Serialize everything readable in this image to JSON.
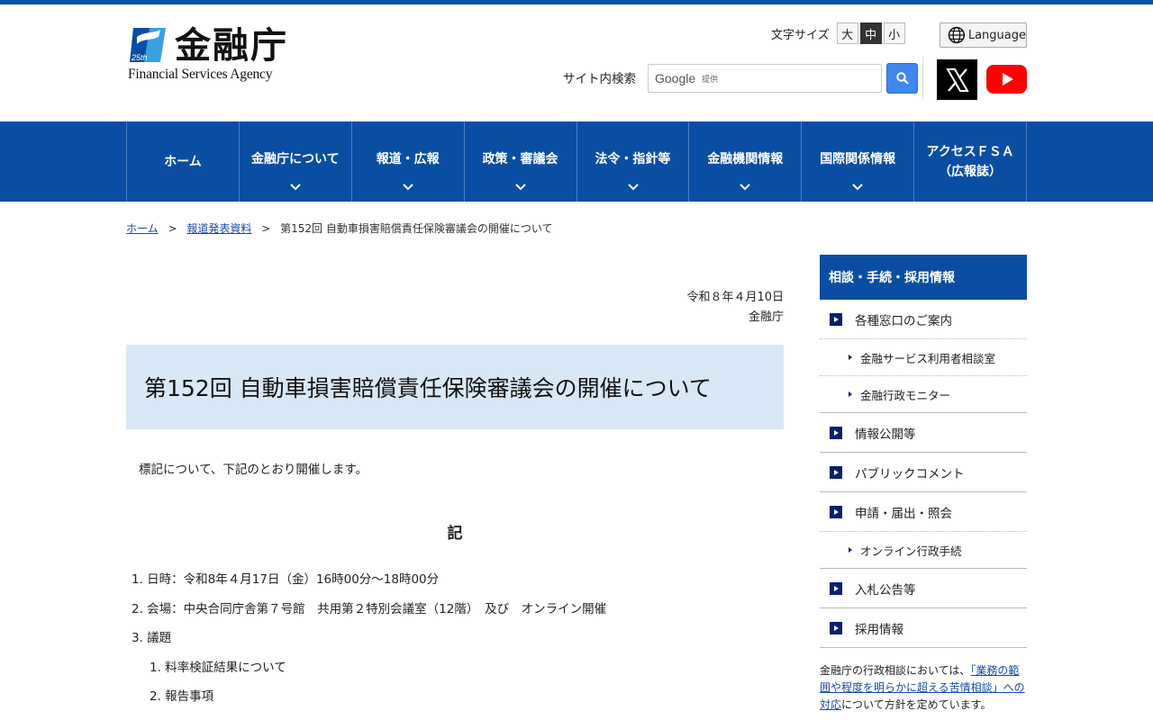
{
  "header": {
    "logo_kanji": "金融庁",
    "logo_english": "Financial Services Agency",
    "logo_badge": "25th",
    "fontsize_label": "文字サイズ",
    "fontsize_options": [
      "大",
      "中",
      "小"
    ],
    "fontsize_selected": "中",
    "language_label": "Language",
    "search_label": "サイト内検索",
    "search_brand": "Google",
    "search_brand_suffix": "提供",
    "social": [
      "x-icon",
      "youtube-icon"
    ]
  },
  "nav": {
    "items": [
      {
        "label": "ホーム",
        "chevron": false
      },
      {
        "label": "金融庁について",
        "chevron": true
      },
      {
        "label": "報道・広報",
        "chevron": true
      },
      {
        "label": "政策・審議会",
        "chevron": true
      },
      {
        "label": "法令・指針等",
        "chevron": true
      },
      {
        "label": "金融機関情報",
        "chevron": true
      },
      {
        "label": "国際関係情報",
        "chevron": true
      },
      {
        "label": "アクセスＦＳＡ\n（広報誌）",
        "line1": "アクセスＦＳＡ",
        "line2": "（広報誌）",
        "chevron": false
      }
    ]
  },
  "breadcrumb": {
    "home": "ホーム",
    "sep": ">",
    "parent": "報道発表資料",
    "current": "第152回 自動車損害賠償責任保険審議会の開催について"
  },
  "main": {
    "date": "令和８年４月10日",
    "issuer": "金融庁",
    "title": "第152回 自動車損害賠償責任保険審議会の開催について",
    "intro": "標記について、下記のとおり開催します。",
    "ki": "記",
    "items": [
      "1. 日時：令和8年４月17日（金）16時00分～18時00分",
      "2. 会場：中央合同庁舎第７号館　共用第２特別会議室（12階）　及び　オンライン開催",
      "3. 議題"
    ],
    "subitems": [
      "1. 料率検証結果について",
      "2. 報告事項"
    ]
  },
  "sidebar": {
    "head": "相談・手続・採用情報",
    "entries": [
      {
        "type": "main",
        "label": "各種窓口のご案内",
        "dotted": true
      },
      {
        "type": "sub",
        "label": "金融サービス利用者相談室"
      },
      {
        "type": "sub",
        "label": "金融行政モニター",
        "last": true
      },
      {
        "type": "main",
        "label": "情報公開等"
      },
      {
        "type": "main",
        "label": "パブリックコメント"
      },
      {
        "type": "main",
        "label": "申請・届出・照会",
        "dotted": true
      },
      {
        "type": "sub",
        "label": "オンライン行政手続",
        "last": true
      },
      {
        "type": "main",
        "label": "入札公告等"
      },
      {
        "type": "main",
        "label": "採用情報"
      }
    ],
    "note_pre": "金融庁の行政相談においては、",
    "note_link": "「業務の範囲や程度を明らかに超える苦情相談」への対応",
    "note_post": "について方針を定めています。"
  }
}
